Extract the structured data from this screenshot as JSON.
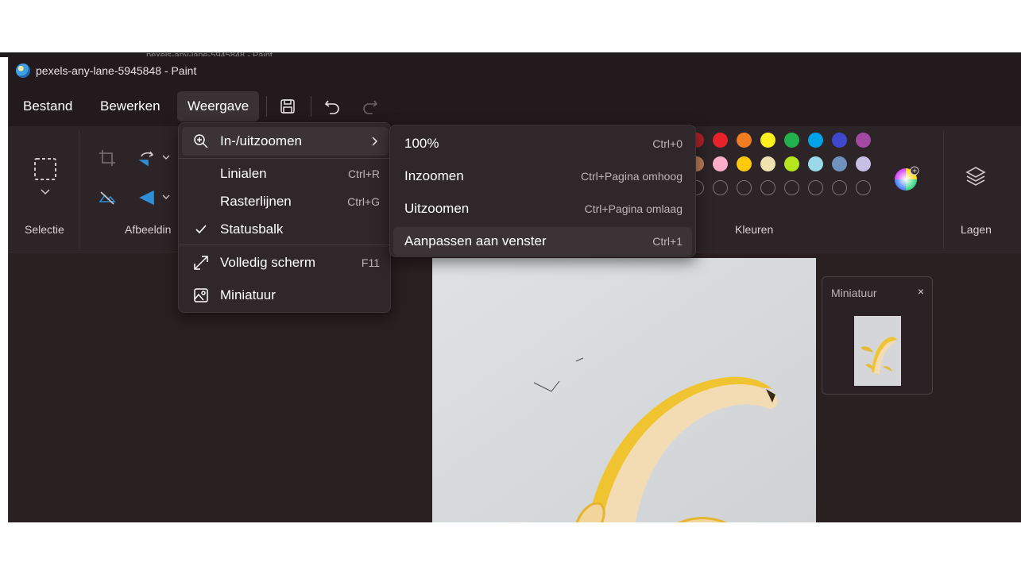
{
  "background_window": {
    "title_fragment": "pexels-any-lane-5945848 - Paint"
  },
  "window": {
    "title": "pexels-any-lane-5945848 - Paint"
  },
  "menubar": {
    "items": [
      {
        "label": "Bestand"
      },
      {
        "label": "Bewerken"
      },
      {
        "label": "Weergave"
      }
    ],
    "tools": [
      "save-icon",
      "undo-icon",
      "redo-icon"
    ]
  },
  "ribbon": {
    "groups": {
      "selection": "Selectie",
      "image": "Afbeeldin",
      "colors": "Kleuren",
      "layers": "Lagen"
    },
    "colors": {
      "row1": [
        "#b0202a",
        "#e8222a",
        "#f07d22",
        "#fff01f",
        "#22b14c",
        "#00a2e8",
        "#3f48cc",
        "#a349a4"
      ],
      "row2": [
        "#b97a57",
        "#ffaec9",
        "#ffc90e",
        "#efe4b0",
        "#b5e61d",
        "#99d9ea",
        "#7092be",
        "#c8bfe7"
      ],
      "row3_empty_count": 8
    }
  },
  "view_menu": {
    "items": [
      {
        "icon": "zoom-icon",
        "label": "In-/uitzoomen",
        "shortcut": "",
        "has_submenu": true
      },
      {
        "icon": "",
        "label": "Linialen",
        "shortcut": "Ctrl+R"
      },
      {
        "icon": "",
        "label": "Rasterlijnen",
        "shortcut": "Ctrl+G"
      },
      {
        "icon": "check-icon",
        "label": "Statusbalk",
        "shortcut": ""
      },
      {
        "icon": "fullscreen-icon",
        "label": "Volledig scherm",
        "shortcut": "F11"
      },
      {
        "icon": "thumbnail-icon",
        "label": "Miniatuur",
        "shortcut": ""
      }
    ]
  },
  "zoom_submenu": {
    "items": [
      {
        "label": "100%",
        "shortcut": "Ctrl+0"
      },
      {
        "label": "Inzoomen",
        "shortcut": "Ctrl+Pagina omhoog"
      },
      {
        "label": "Uitzoomen",
        "shortcut": "Ctrl+Pagina omlaag"
      },
      {
        "label": "Aanpassen aan venster",
        "shortcut": "Ctrl+1"
      }
    ]
  },
  "thumbnail_panel": {
    "title": "Miniatuur",
    "close": "×"
  }
}
